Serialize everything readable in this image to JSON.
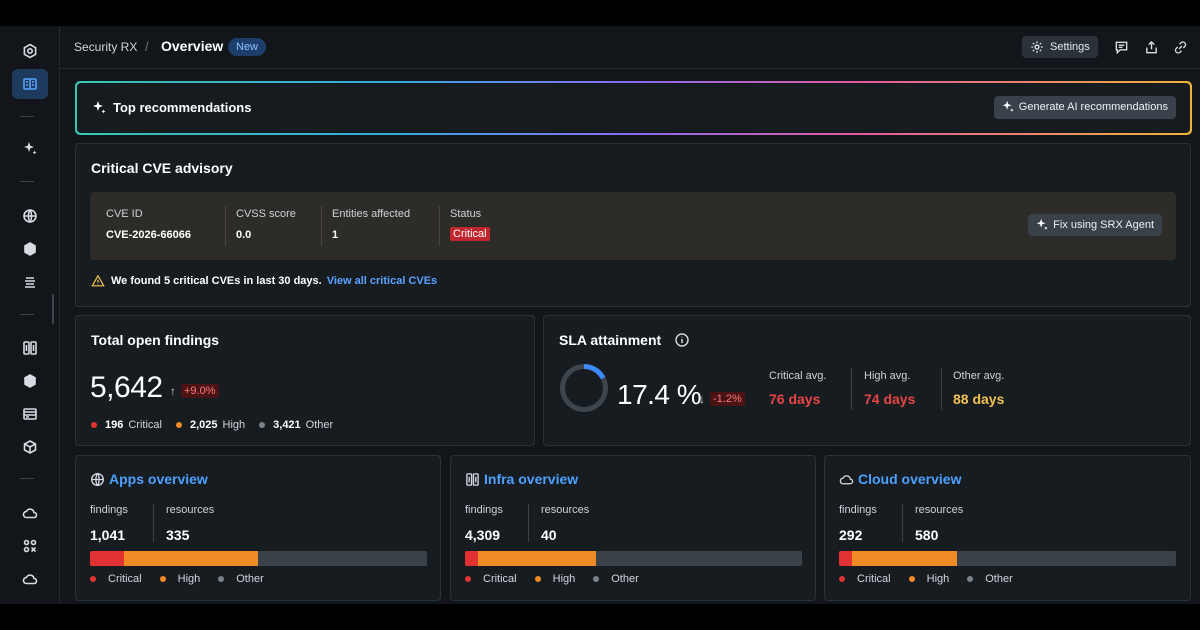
{
  "header": {
    "breadcrumb_root": "Security RX",
    "breadcrumb_sep": "/",
    "breadcrumb_current": "Overview",
    "badge": "New",
    "settings_label": "Settings"
  },
  "recommendations": {
    "title": "Top recommendations",
    "button_label": "Generate AI recommendations"
  },
  "cve": {
    "title": "Critical CVE advisory",
    "columns": [
      {
        "label": "CVE ID",
        "value": "CVE-2026-66066"
      },
      {
        "label": "CVSS score",
        "value": "0.0"
      },
      {
        "label": "Entities affected",
        "value": "1"
      },
      {
        "label": "Status",
        "value": "Critical"
      }
    ],
    "fix_button": "Fix using SRX Agent",
    "warning_text": "We found 5 critical CVEs in last 30 days.",
    "warning_link": "View all critical CVEs"
  },
  "findings": {
    "title": "Total open findings",
    "total": "5,642",
    "delta": "+9.0%",
    "critical_count": "196",
    "critical_label": "Critical",
    "high_count": "2,025",
    "high_label": "High",
    "other_count": "3,421",
    "other_label": "Other"
  },
  "sla": {
    "title": "SLA attainment",
    "percent": "17.4 %",
    "percent_value": 17.4,
    "delta": "-1.2%",
    "critical_label": "Critical avg.",
    "critical_value": "76 days",
    "high_label": "High avg.",
    "high_value": "74 days",
    "other_label": "Other avg.",
    "other_value": "88 days"
  },
  "overviews": [
    {
      "title": "Apps overview",
      "icon": "globe-icon",
      "findings_label": "findings",
      "findings": "1,041",
      "resources_label": "resources",
      "resources": "335",
      "critical_frac": 0.1,
      "high_frac": 0.4
    },
    {
      "title": "Infra overview",
      "icon": "infra-icon",
      "findings_label": "findings",
      "findings": "4,309",
      "resources_label": "resources",
      "resources": "40",
      "critical_frac": 0.04,
      "high_frac": 0.35
    },
    {
      "title": "Cloud overview",
      "icon": "cloud-icon",
      "findings_label": "findings",
      "findings": "292",
      "resources_label": "resources",
      "resources": "580",
      "critical_frac": 0.04,
      "high_frac": 0.31
    }
  ],
  "legend": {
    "critical": "Critical",
    "high": "High",
    "other": "Other"
  },
  "colors": {
    "critical": "#e03232",
    "high": "#f08a24",
    "other": "#7a828a",
    "accent": "#4ea0ff",
    "other_sla": "#f2c14e"
  }
}
